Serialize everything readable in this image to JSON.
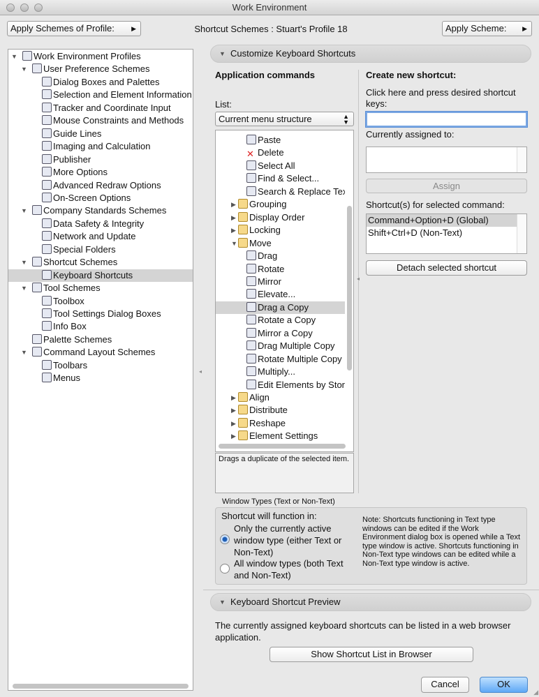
{
  "window": {
    "title": "Work Environment"
  },
  "topbar": {
    "apply_profile_label": "Apply Schemes of Profile:",
    "scheme_caption": "Shortcut Schemes : Stuart's Profile 18",
    "apply_scheme_label": "Apply Scheme:"
  },
  "tree": [
    {
      "label": "Work Environment Profiles",
      "level": 0,
      "expander": "down",
      "icon": "profile-icon"
    },
    {
      "label": "User Preference Schemes",
      "level": 1,
      "expander": "down",
      "icon": "user-prefs-icon"
    },
    {
      "label": "Dialog Boxes and Palettes",
      "level": 2,
      "icon": "dialog-icon"
    },
    {
      "label": "Selection and Element Information",
      "level": 2,
      "icon": "selection-icon"
    },
    {
      "label": "Tracker and Coordinate Input",
      "level": 2,
      "icon": "tracker-icon"
    },
    {
      "label": "Mouse Constraints and Methods",
      "level": 2,
      "icon": "mouse-icon"
    },
    {
      "label": "Guide Lines",
      "level": 2,
      "icon": "guide-lines-icon"
    },
    {
      "label": "Imaging and Calculation",
      "level": 2,
      "icon": "imaging-icon"
    },
    {
      "label": "Publisher",
      "level": 2,
      "icon": "publisher-icon"
    },
    {
      "label": "More Options",
      "level": 2,
      "icon": "more-options-icon"
    },
    {
      "label": "Advanced Redraw Options",
      "level": 2,
      "icon": "redraw-icon"
    },
    {
      "label": "On-Screen Options",
      "level": 2,
      "icon": "onscreen-icon"
    },
    {
      "label": "Company Standards Schemes",
      "level": 1,
      "expander": "down",
      "icon": "company-icon"
    },
    {
      "label": "Data Safety & Integrity",
      "level": 2,
      "icon": "data-safety-icon"
    },
    {
      "label": "Network and Update",
      "level": 2,
      "icon": "network-icon"
    },
    {
      "label": "Special Folders",
      "level": 2,
      "icon": "folder-icon"
    },
    {
      "label": "Shortcut Schemes",
      "level": 1,
      "expander": "down",
      "icon": "shortcut-icon"
    },
    {
      "label": "Keyboard Shortcuts",
      "level": 2,
      "icon": "keyboard-icon",
      "selected": true
    },
    {
      "label": "Tool Schemes",
      "level": 1,
      "expander": "down",
      "icon": "tool-schemes-icon"
    },
    {
      "label": "Toolbox",
      "level": 2,
      "icon": "toolbox-icon"
    },
    {
      "label": "Tool Settings Dialog Boxes",
      "level": 2,
      "icon": "tool-settings-icon"
    },
    {
      "label": "Info Box",
      "level": 2,
      "icon": "info-box-icon"
    },
    {
      "label": "Palette Schemes",
      "level": 1,
      "icon": "palette-icon"
    },
    {
      "label": "Command Layout Schemes",
      "level": 1,
      "expander": "down",
      "icon": "command-layout-icon"
    },
    {
      "label": "Toolbars",
      "level": 2,
      "icon": "toolbars-icon"
    },
    {
      "label": "Menus",
      "level": 2,
      "icon": "menus-icon"
    }
  ],
  "customize": {
    "header": "Customize Keyboard Shortcuts",
    "app_commands": "Application commands",
    "list_label": "List:",
    "list_value": "Current menu structure",
    "commands": [
      {
        "label": "Paste",
        "level": 2,
        "icon": "paste-icon"
      },
      {
        "label": "Delete",
        "level": 2,
        "icon": "delete-icon"
      },
      {
        "label": "Select All",
        "level": 2,
        "icon": "select-all-icon"
      },
      {
        "label": "Find & Select...",
        "level": 2,
        "icon": "find-select-icon"
      },
      {
        "label": "Search & Replace Text...",
        "level": 2,
        "icon": "search-replace-icon"
      },
      {
        "label": "Grouping",
        "level": 1,
        "expander": "right",
        "icon": "folder-icon"
      },
      {
        "label": "Display Order",
        "level": 1,
        "expander": "right",
        "icon": "folder-icon"
      },
      {
        "label": "Locking",
        "level": 1,
        "expander": "right",
        "icon": "folder-icon"
      },
      {
        "label": "Move",
        "level": 1,
        "expander": "down",
        "icon": "folder-icon"
      },
      {
        "label": "Drag",
        "level": 2,
        "icon": "drag-icon"
      },
      {
        "label": "Rotate",
        "level": 2,
        "icon": "rotate-icon"
      },
      {
        "label": "Mirror",
        "level": 2,
        "icon": "mirror-icon"
      },
      {
        "label": "Elevate...",
        "level": 2,
        "icon": "elevate-icon"
      },
      {
        "label": "Drag a Copy",
        "level": 2,
        "icon": "drag-copy-icon",
        "selected": true
      },
      {
        "label": "Rotate a Copy",
        "level": 2,
        "icon": "rotate-copy-icon"
      },
      {
        "label": "Mirror a Copy",
        "level": 2,
        "icon": "mirror-copy-icon"
      },
      {
        "label": "Drag Multiple Copy",
        "level": 2,
        "icon": "drag-multiple-icon"
      },
      {
        "label": "Rotate Multiple Copy",
        "level": 2,
        "icon": "rotate-multiple-icon"
      },
      {
        "label": "Multiply...",
        "level": 2,
        "icon": "multiply-icon"
      },
      {
        "label": "Edit Elements by Stories",
        "level": 2,
        "icon": "edit-elements-icon"
      },
      {
        "label": "Align",
        "level": 1,
        "expander": "right",
        "icon": "folder-icon"
      },
      {
        "label": "Distribute",
        "level": 1,
        "expander": "right",
        "icon": "folder-icon"
      },
      {
        "label": "Reshape",
        "level": 1,
        "expander": "right",
        "icon": "folder-icon"
      },
      {
        "label": "Element Settings",
        "level": 1,
        "expander": "right",
        "icon": "folder-icon"
      }
    ],
    "description": "Drags a duplicate of the selected item.",
    "create_title": "Create new shortcut:",
    "create_instructions": "Click here and press desired shortcut keys:",
    "shortcut_field_value": "",
    "currently_assigned_label": "Currently assigned to:",
    "assign_label": "Assign",
    "shortcuts_for_selected_label": "Shortcut(s) for selected command:",
    "shortcuts_for_selected": [
      {
        "label": "Command+Option+D (Global)",
        "selected": true
      },
      {
        "label": "Shift+Ctrl+D (Non-Text)",
        "selected": false
      }
    ],
    "detach_label": "Detach selected shortcut"
  },
  "window_types": {
    "title": "Window Types (Text or Non-Text)",
    "function_in": "Shortcut will function in:",
    "option1": "Only the currently active window type (either Text or Non-Text)",
    "option2": "All window types (both Text and Non-Text)",
    "selected": 1,
    "note": "Note: Shortcuts functioning in Text type windows can be edited if the Work Environment dialog box is opened while a Text type window is active. Shortcuts functioning in Non-Text type windows can be edited while a Non-Text type window is active."
  },
  "preview": {
    "header": "Keyboard Shortcut Preview",
    "text": "The currently assigned keyboard shortcuts can be listed in a web browser application.",
    "button": "Show Shortcut List in Browser"
  },
  "footer": {
    "cancel": "Cancel",
    "ok": "OK"
  },
  "colors": {
    "accent": "#1f5fb6",
    "selection": "#d4d4d4",
    "ok_button": "#5fa8f6"
  }
}
